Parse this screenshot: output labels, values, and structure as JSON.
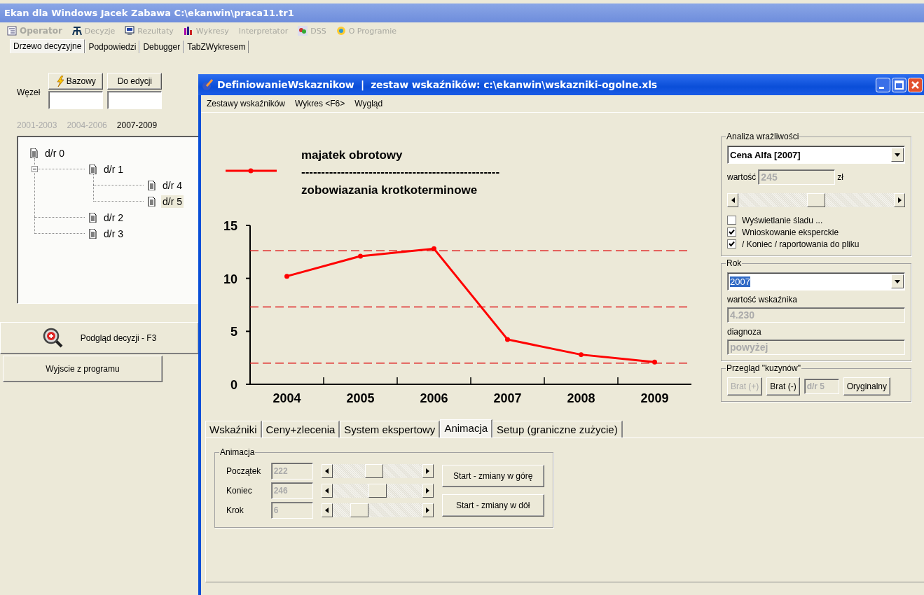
{
  "window": {
    "title": "Ekan dla Windows Jacek Zabawa C:\\ekanwin\\praca11.tr1"
  },
  "menu": [
    {
      "label": "Operator",
      "disabled": true,
      "bold": true
    },
    {
      "label": "Decyzje",
      "disabled": true,
      "bold": false
    },
    {
      "label": "Rezultaty",
      "disabled": true,
      "bold": false
    },
    {
      "label": "Wykresy",
      "disabled": true,
      "bold": false
    },
    {
      "label": "Interpretator",
      "disabled": true,
      "bold": false
    },
    {
      "label": "DSS",
      "disabled": true,
      "bold": false
    },
    {
      "label": "O Programie",
      "disabled": true,
      "bold": false
    }
  ],
  "tabs": [
    {
      "label": "Drzewo decyzyjne",
      "selected": true
    },
    {
      "label": "Podpowiedzi",
      "selected": false
    },
    {
      "label": "Debugger",
      "selected": false
    },
    {
      "label": "TabZWykresem",
      "selected": false
    }
  ],
  "sidebar": {
    "node_label": "Węzeł",
    "buttons": [
      {
        "label": "Bazowy",
        "kind": "lightning"
      },
      {
        "label": "Do edycji",
        "kind": "plain"
      }
    ],
    "periods": [
      {
        "label": "2001-2003",
        "selected": false
      },
      {
        "label": "2004-2006",
        "selected": false
      },
      {
        "label": "2007-2009",
        "selected": true
      }
    ],
    "tree": [
      {
        "label": "d/r 0",
        "selected": false,
        "children": [
          {
            "label": "d/r 1",
            "selected": false,
            "expanded": true,
            "children": [
              {
                "label": "d/r 4",
                "selected": false
              },
              {
                "label": "d/r 5",
                "selected": true
              }
            ]
          },
          {
            "label": "d/r 2",
            "selected": false
          },
          {
            "label": "d/r 3",
            "selected": false
          }
        ]
      }
    ],
    "preview_button": "Podgląd decyzji - F3",
    "exit_button": "Wyjscie z programu"
  },
  "child_window": {
    "title": "DefiniowanieWskaznikow  |  zestaw wskaźników: c:\\ekanwin\\wskazniki-ogolne.xls",
    "menu": [
      "Zestawy wskaźników",
      "Wykres <F6>",
      "Wygląd"
    ],
    "chart": {
      "legend_separator": "--------------------------------------------------",
      "legend_denominator": "zobowiazania krotkoterminowe",
      "chart_data": {
        "type": "line",
        "categories": [
          "2004",
          "2005",
          "2006",
          "2007",
          "2008",
          "2009"
        ],
        "series": [
          {
            "name": "majatek obrotowy",
            "color": "#ff0000",
            "marker": "circle",
            "values": [
              10.2,
              12.1,
              12.8,
              4.23,
              2.8,
              2.1
            ]
          }
        ],
        "ylim": [
          0,
          15
        ],
        "yticks": [
          0,
          5,
          10,
          15
        ],
        "ref_lines": [
          {
            "axis": "y",
            "value": 12.6,
            "color": "#e02020"
          },
          {
            "axis": "y",
            "value": 7.3,
            "color": "#e02020"
          },
          {
            "axis": "y",
            "value": 2.0,
            "color": "#e02020"
          }
        ]
      }
    }
  },
  "bottom_tabs": [
    {
      "label": "Wskaźniki",
      "selected": false
    },
    {
      "label": "Ceny+zlecenia",
      "selected": false
    },
    {
      "label": "System ekspertowy",
      "selected": false
    },
    {
      "label": "Animacja",
      "selected": true
    },
    {
      "label": "Setup (graniczne zużycie)",
      "selected": false
    }
  ],
  "animation": {
    "title": "Animacja",
    "rows": [
      {
        "label": "Początek",
        "value": "222"
      },
      {
        "label": "Koniec",
        "value": "246"
      },
      {
        "label": "Krok",
        "value": "6"
      }
    ],
    "buttons": [
      "Start - zmiany w górę",
      "Start - zmiany w dół"
    ]
  },
  "sensitivity": {
    "title": "Analiza wrażliwości",
    "combo": "Cena Alfa [2007]",
    "value_label": "wartość",
    "value": "245",
    "unit": "zł",
    "checkboxes": [
      {
        "label": "Wyświetlanie śladu ...",
        "checked": false
      },
      {
        "label": "Wnioskowanie eksperckie",
        "checked": true
      },
      {
        "label": "/ Koniec / raportowania do pliku",
        "checked": true
      }
    ]
  },
  "year": {
    "title": "Rok",
    "combo": "2007",
    "indicator_label": "wartość wskaźnika",
    "indicator": "4.230",
    "diagnosis_label": "diagnoza",
    "diagnosis": "powyżej"
  },
  "cousins": {
    "title": "Przegląd \"kuzynów\"",
    "buttons": [
      {
        "label": "Brat (+)",
        "disabled": true
      },
      {
        "label": "Brat (-)",
        "disabled": false
      }
    ],
    "field": "d/r 5",
    "original_button": "Oryginalny"
  }
}
